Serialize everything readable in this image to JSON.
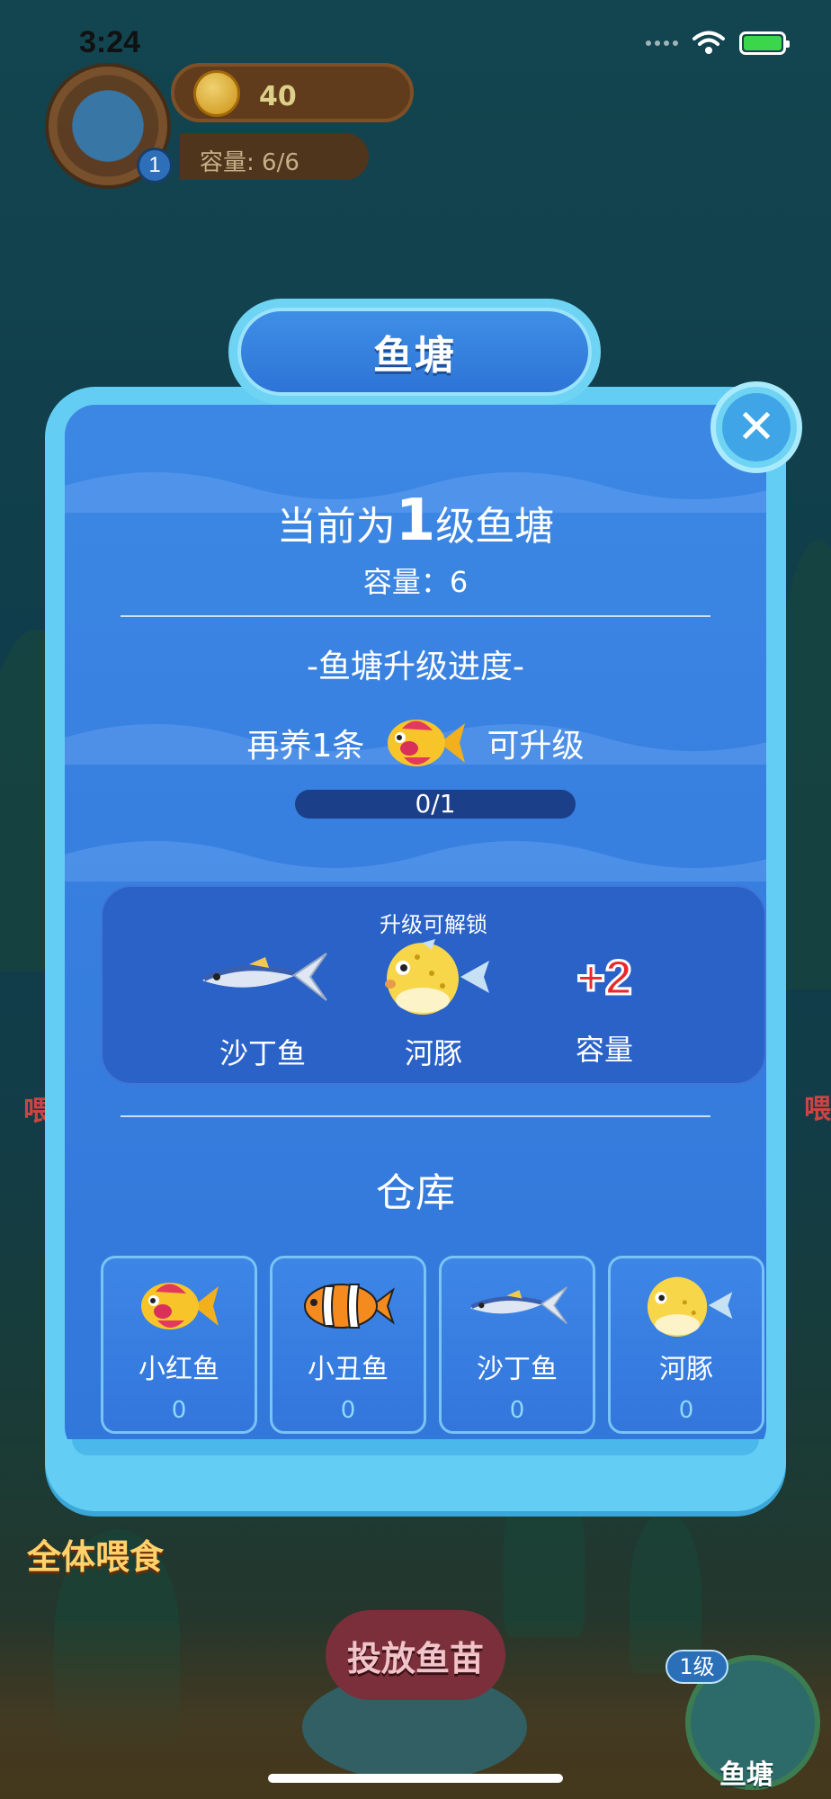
{
  "status_bar": {
    "time": "3:24"
  },
  "hud": {
    "level": "1",
    "coins": "40",
    "capacity": "容量: 6/6"
  },
  "modal": {
    "title": "鱼塘",
    "close_symbol": "✕",
    "level_prefix": "当前为",
    "level_number": "1",
    "level_suffix": "级鱼塘",
    "capacity_text": "容量：6",
    "progress_title": "-鱼塘升级进度-",
    "raise_prefix": "再养1条",
    "raise_suffix": "可升级",
    "progress": {
      "current": 0,
      "total": 1,
      "text": "0/1"
    },
    "unlock": {
      "title": "升级可解锁",
      "items": [
        {
          "name": "沙丁鱼",
          "icon": "sardine-icon"
        },
        {
          "name": "河豚",
          "icon": "pufferfish-icon"
        },
        {
          "name": "容量",
          "bonus": "+2"
        }
      ]
    },
    "warehouse": {
      "title": "仓库",
      "items": [
        {
          "name": "小红鱼",
          "count": "0",
          "icon": "red-fish-icon"
        },
        {
          "name": "小丑鱼",
          "count": "0",
          "icon": "clownfish-icon"
        },
        {
          "name": "沙丁鱼",
          "count": "0",
          "icon": "sardine-icon"
        },
        {
          "name": "河豚",
          "count": "0",
          "icon": "pufferfish-icon"
        }
      ]
    }
  },
  "controls": {
    "feed_all": "全体喂食",
    "release": "投放鱼苗",
    "pond_level": "1级",
    "pond_label": "鱼塘",
    "side_feed": "喂",
    "side_feed_right": "喂"
  },
  "colors": {
    "modal_rim": "#64cdf3",
    "modal_body": "#3880e0",
    "unlock_box": "#2a62c8",
    "bonus_red": "#e8282c"
  }
}
